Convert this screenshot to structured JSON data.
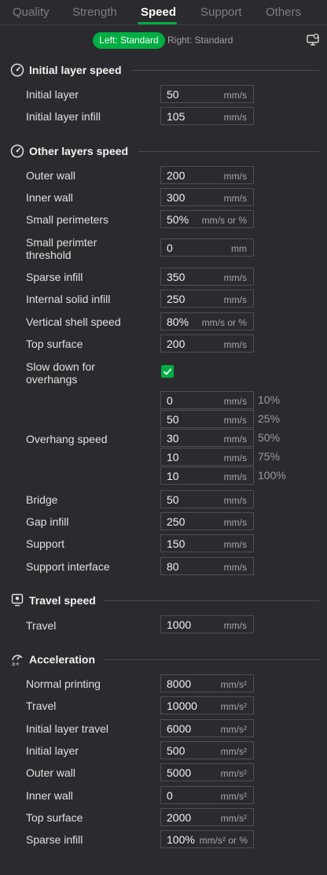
{
  "tabs": [
    {
      "label": "Quality"
    },
    {
      "label": "Strength"
    },
    {
      "label": "Speed"
    },
    {
      "label": "Support"
    },
    {
      "label": "Others"
    }
  ],
  "extruder": {
    "left": "Left: Standard",
    "right": "Right: Standard"
  },
  "accent_color": "#00ae42",
  "sections": {
    "initial_layer_speed": {
      "title": "Initial layer speed",
      "rows": [
        {
          "label": "Initial layer",
          "value": "50",
          "unit": "mm/s"
        },
        {
          "label": "Initial layer infill",
          "value": "105",
          "unit": "mm/s"
        }
      ]
    },
    "other_layers_speed": {
      "title": "Other layers speed",
      "rows": [
        {
          "label": "Outer wall",
          "value": "200",
          "unit": "mm/s"
        },
        {
          "label": "Inner wall",
          "value": "300",
          "unit": "mm/s"
        },
        {
          "label": "Small perimeters",
          "value": "50%",
          "unit": "mm/s or %"
        },
        {
          "label1": "Small perimter",
          "label2": "threshold",
          "value": "0",
          "unit": "mm"
        },
        {
          "label": "Sparse infill",
          "value": "350",
          "unit": "mm/s"
        },
        {
          "label": "Internal solid infill",
          "value": "250",
          "unit": "mm/s"
        },
        {
          "label": "Vertical shell speed",
          "value": "80%",
          "unit": "mm/s or %"
        },
        {
          "label": "Top surface",
          "value": "200",
          "unit": "mm/s"
        }
      ],
      "slow_down": {
        "label1": "Slow down for",
        "label2": "overhangs",
        "checked": true
      },
      "overhang": {
        "label": "Overhang speed",
        "rows": [
          {
            "value": "0",
            "unit": "mm/s",
            "pct": "10%"
          },
          {
            "value": "50",
            "unit": "mm/s",
            "pct": "25%"
          },
          {
            "value": "30",
            "unit": "mm/s",
            "pct": "50%"
          },
          {
            "value": "10",
            "unit": "mm/s",
            "pct": "75%"
          },
          {
            "value": "10",
            "unit": "mm/s",
            "pct": "100%"
          }
        ]
      },
      "rows2": [
        {
          "label": "Bridge",
          "value": "50",
          "unit": "mm/s"
        },
        {
          "label": "Gap infill",
          "value": "250",
          "unit": "mm/s"
        },
        {
          "label": "Support",
          "value": "150",
          "unit": "mm/s"
        },
        {
          "label": "Support interface",
          "value": "80",
          "unit": "mm/s"
        }
      ]
    },
    "travel_speed": {
      "title": "Travel speed",
      "rows": [
        {
          "label": "Travel",
          "value": "1000",
          "unit": "mm/s"
        }
      ]
    },
    "acceleration": {
      "title": "Acceleration",
      "rows": [
        {
          "label": "Normal printing",
          "value": "8000",
          "unit": "mm/s²"
        },
        {
          "label": "Travel",
          "value": "10000",
          "unit": "mm/s²"
        },
        {
          "label": "Initial layer travel",
          "value": "6000",
          "unit": "mm/s²"
        },
        {
          "label": "Initial layer",
          "value": "500",
          "unit": "mm/s²"
        },
        {
          "label": "Outer wall",
          "value": "5000",
          "unit": "mm/s²"
        },
        {
          "label": "Inner wall",
          "value": "0",
          "unit": "mm/s²"
        },
        {
          "label": "Top surface",
          "value": "2000",
          "unit": "mm/s²"
        },
        {
          "label": "Sparse infill",
          "value": "100%",
          "unit": "mm/s² or %"
        }
      ]
    }
  }
}
